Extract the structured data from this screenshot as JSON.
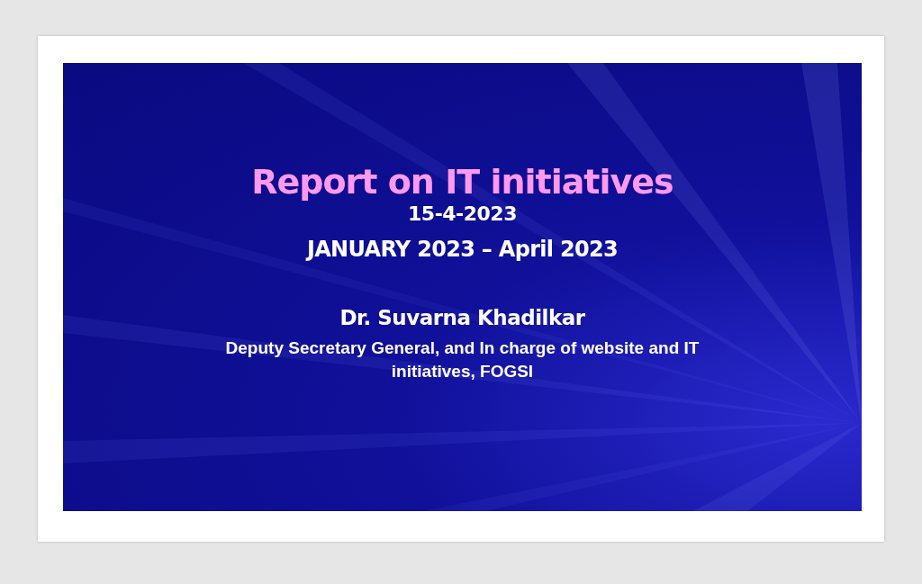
{
  "slide": {
    "title": "Report on IT initiatives",
    "date": "15-4-2023",
    "period": "JANUARY 2023 – April 2023",
    "presenter": "Dr. Suvarna Khadilkar",
    "role": "Deputy Secretary General, and In charge of website and IT initiatives, FOGSI"
  }
}
